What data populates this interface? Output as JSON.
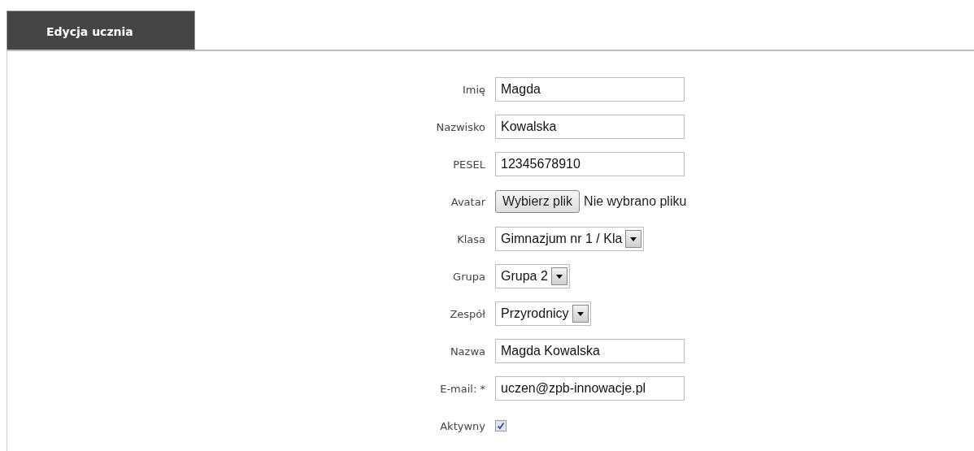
{
  "tab": {
    "label": "Edycja ucznia"
  },
  "fields": [
    {
      "kind": "text",
      "label": "Imię",
      "value": "Magda"
    },
    {
      "kind": "text",
      "label": "Nazwisko",
      "value": "Kowalska"
    },
    {
      "kind": "text",
      "label": "PESEL",
      "value": "12345678910"
    },
    {
      "kind": "file",
      "label": "Avatar",
      "button": "Wybierz plik",
      "status": "Nie wybrano pliku"
    },
    {
      "kind": "select",
      "label": "Klasa",
      "value": "Gimnazjum nr 1 / Kla"
    },
    {
      "kind": "select",
      "label": "Grupa",
      "value": "Grupa 2"
    },
    {
      "kind": "select",
      "label": "Zespół",
      "value": "Przyrodnicy"
    },
    {
      "kind": "text",
      "label": "Nazwa",
      "value": "Magda Kowalska"
    },
    {
      "kind": "text",
      "label": "E-mail: *",
      "value": "uczen@zpb-innowacje.pl"
    },
    {
      "kind": "checkbox",
      "label": "Aktywny",
      "checked": true
    }
  ]
}
